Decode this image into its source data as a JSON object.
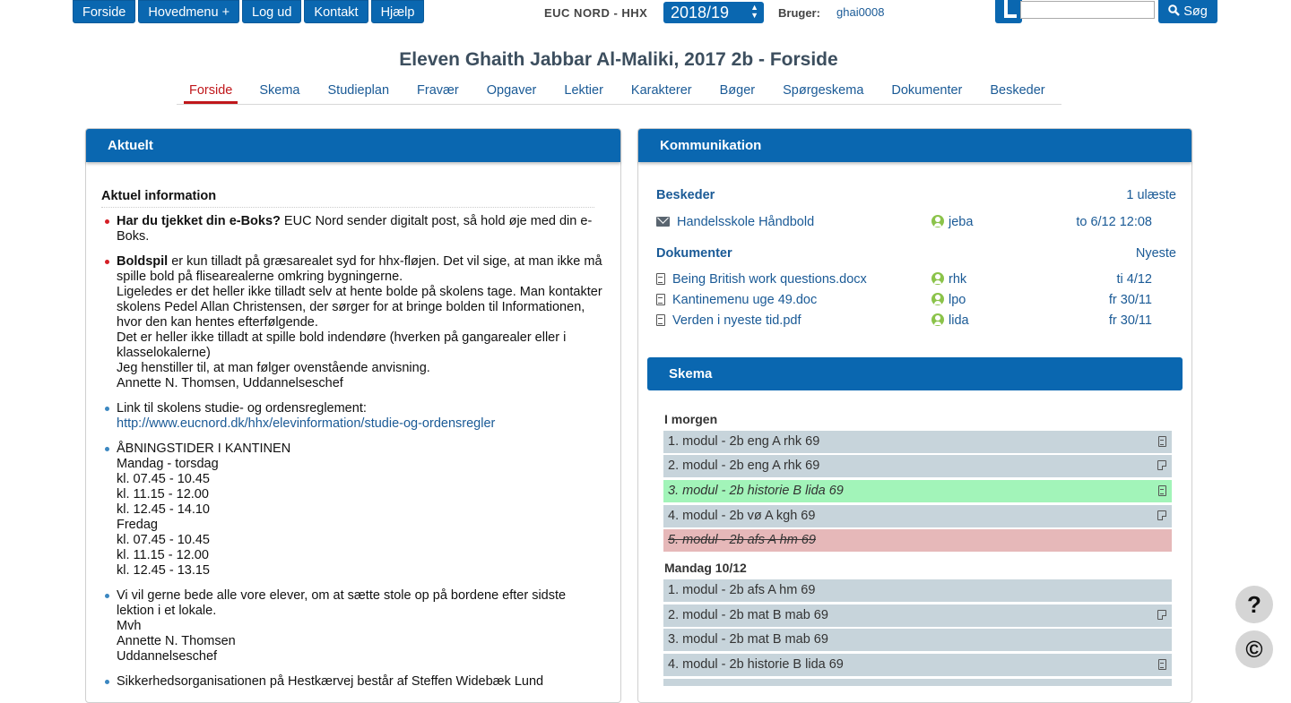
{
  "topbar": {
    "nav": [
      "Forside",
      "Hovedmenu +",
      "Log ud",
      "Kontakt",
      "Hjælp"
    ],
    "school": "EUC NORD - HHX",
    "year": "2018/19",
    "user_label": "Bruger:",
    "username": "ghai0008",
    "search_value": "",
    "search_button": "Søg",
    "search_icon": "magnifier-icon",
    "logo_icon": "lectio-logo-icon"
  },
  "page": {
    "title": "Eleven Ghaith Jabbar Al-Maliki, 2017 2b - Forside",
    "tabs": [
      "Forside",
      "Skema",
      "Studieplan",
      "Fravær",
      "Opgaver",
      "Lektier",
      "Karakterer",
      "Bøger",
      "Spørgeskema",
      "Dokumenter",
      "Beskeder"
    ],
    "active_tab": "Forside"
  },
  "aktuelt": {
    "header": "Aktuelt",
    "section_title": "Aktuel information",
    "item1": {
      "bold": "Har du tjekket din e-Boks?",
      "text": " EUC Nord sender digitalt post, så hold øje med din e-Boks."
    },
    "item2": {
      "bold": "Boldspil",
      "line1": " er kun tilladt på græsarealet syd for hhx-fløjen. Det vil sige, at man ikke må spille bold på flisearealerne omkring bygningerne.",
      "line2": "Ligeledes er det heller ikke tilladt selv at hente bolde på skolens tage. Man kontakter skolens Pedel Allan Christensen, der sørger for at bringe bolden til Informationen, hvor den kan hentes efterfølgende.",
      "line3": "Det er heller ikke tilladt at spille bold indendøre (hverken på gangarealer eller i klasselokalerne)",
      "line4": "Jeg henstiller til, at man følger ovenstående anvisning.",
      "line5": "Annette N. Thomsen, Uddannelseschef"
    },
    "item3": {
      "text": "Link til skolens studie- og ordensreglement:",
      "link": "http://www.eucnord.dk/hhx/elevinformation/studie-og-ordensregler"
    },
    "item4": [
      "ÅBNINGSTIDER I KANTINEN",
      "Mandag - torsdag",
      "kl.  07.45 - 10.45",
      "kl. 11.15 - 12.00",
      "kl. 12.45 - 14.10",
      "Fredag",
      "kl. 07.45 - 10.45",
      "kl. 11.15 - 12.00",
      "kl. 12.45 - 13.15"
    ],
    "item5": [
      "Vi vil gerne bede alle vore elever, om at sætte stole op på bordene efter sidste lektion i et lokale.",
      "Mvh",
      "Annette N. Thomsen",
      "Uddannelseschef"
    ],
    "item6": "Sikkerhedsorganisationen på Hestkærvej består af Steffen Widebæk Lund"
  },
  "kommunikation": {
    "header": "Kommunikation",
    "beskeder_label": "Beskeder",
    "beskeder_count": "1 ulæste",
    "message": {
      "title": "Handelsskole Håndbold",
      "user": "jeba",
      "date": "to 6/12 12:08"
    },
    "dokumenter_label": "Dokumenter",
    "dokumenter_sort": "Nyeste",
    "documents": [
      {
        "name": "Being British work questions.docx",
        "user": "rhk",
        "date": "ti 4/12"
      },
      {
        "name": "Kantinemenu uge 49.doc",
        "user": "lpo",
        "date": "fr 30/11"
      },
      {
        "name": "Verden i nyeste tid.pdf",
        "user": "lida",
        "date": "fr 30/11"
      }
    ]
  },
  "skema": {
    "header": "Skema",
    "day1": "I morgen",
    "day1_modules": [
      "1. modul - 2b eng A  rhk  69",
      "2. modul - 2b eng A  rhk  69",
      "3. modul - 2b historie B  lida  69",
      "4. modul - 2b vø A  kgh  69",
      "5. modul - 2b afs A  hm  69"
    ],
    "day2": "Mandag 10/12",
    "day2_modules": [
      "1. modul - 2b afs A  hm  69",
      "2. modul - 2b mat B  mab  69",
      "3. modul - 2b mat B  mab  69",
      "4. modul - 2b historie B  lida  69"
    ]
  },
  "floating": {
    "help": "?",
    "copyright": "©"
  }
}
